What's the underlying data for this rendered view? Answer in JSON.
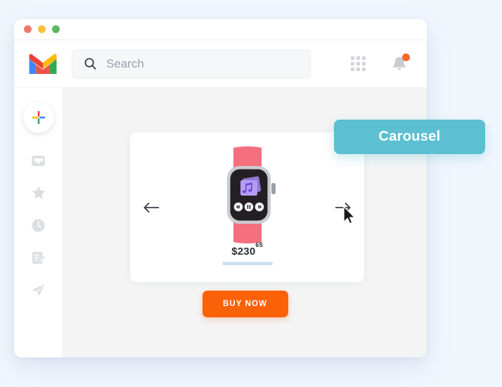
{
  "window": {
    "traffic_lights": [
      {
        "name": "close",
        "color": "#f0796d"
      },
      {
        "name": "minimize",
        "color": "#f7c13d"
      },
      {
        "name": "maximize",
        "color": "#5fb65c"
      }
    ]
  },
  "header": {
    "logo_name": "gmail-logo",
    "search": {
      "value": "",
      "placeholder": "Search",
      "icon": "search-icon"
    },
    "apps_grid_icon": "apps-grid-icon",
    "notifications": {
      "icon": "bell-icon",
      "has_badge": true,
      "badge_color": "#fc6a2c"
    }
  },
  "sidebar": {
    "compose": {
      "label": "Compose",
      "icon": "plus-icon"
    },
    "items": [
      {
        "label": "Inbox",
        "icon": "inbox-icon"
      },
      {
        "label": "Starred",
        "icon": "star-icon"
      },
      {
        "label": "Snoozed",
        "icon": "clock-icon"
      },
      {
        "label": "Drafts",
        "icon": "draft-icon"
      },
      {
        "label": "Sent",
        "icon": "send-icon"
      }
    ]
  },
  "main": {
    "carousel": {
      "prev_label": "Previous",
      "prev_icon": "arrow-left-icon",
      "next_label": "Next",
      "next_icon": "arrow-right-icon",
      "product": {
        "name": "smartwatch",
        "band_color": "#f4707f",
        "case_color": "#c9ccd1",
        "screen_color": "#241f22",
        "app_icon": "music-app-icon",
        "app_icon_color": "#a78bf0",
        "media_controls": [
          "rewind-icon",
          "play-pause-icon",
          "forward-icon"
        ]
      },
      "price": {
        "amount": "$230",
        "cents": "65"
      }
    },
    "buy_button": {
      "label": "BUY NOW",
      "color": "#fb6107"
    }
  },
  "annotation": {
    "label": "Carousel",
    "color": "#5cbfd2"
  },
  "cursor": {
    "name": "mouse-pointer"
  }
}
